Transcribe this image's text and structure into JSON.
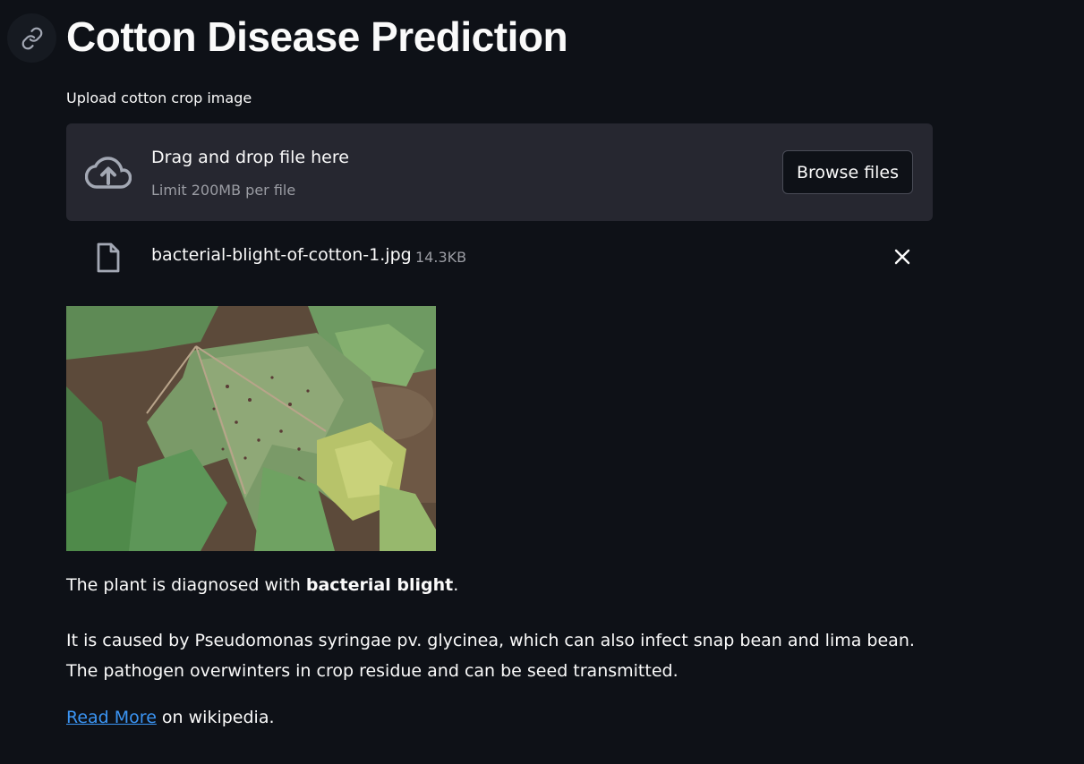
{
  "page": {
    "title": "Cotton Disease Prediction"
  },
  "uploader": {
    "label": "Upload cotton crop image",
    "drop_text": "Drag and drop file here",
    "limit_text": "Limit 200MB per file",
    "browse_label": "Browse files",
    "icon": "cloud-upload-icon"
  },
  "uploaded_file": {
    "name": "bacterial-blight-of-cotton-1.jpg",
    "size": "14.3KB",
    "icon": "file-icon"
  },
  "result": {
    "diagnosis_prefix": "The plant is diagnosed with ",
    "diagnosis_value": "bacterial blight",
    "diagnosis_suffix": ".",
    "description": "It is caused by Pseudomonas syringae pv. glycinea, which can also infect snap bean and lima bean. The pathogen overwinters in crop residue and can be seed transmitted.",
    "link_text": "Read More",
    "link_suffix": " on wikipedia."
  },
  "colors": {
    "background": "#0e1117",
    "dropzone": "#262730",
    "link": "#3b95f4",
    "muted_text": "#9a9ca3"
  }
}
